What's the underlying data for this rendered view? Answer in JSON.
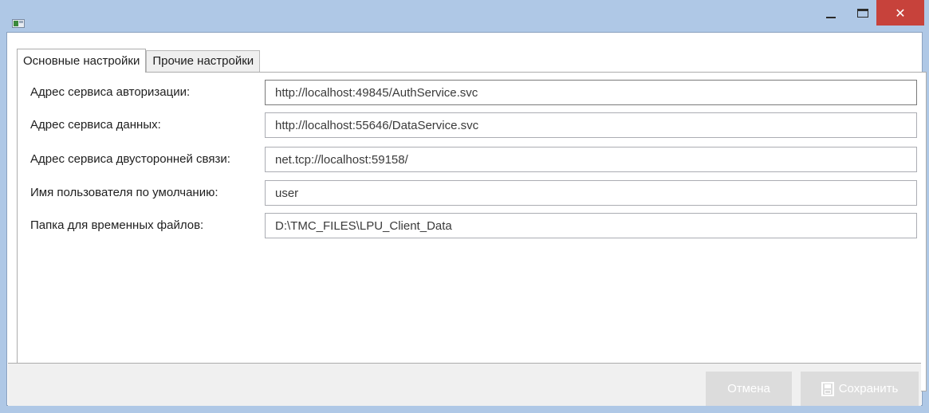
{
  "window": {
    "minimize_glyph": "",
    "close_glyph": "✕"
  },
  "tabs": [
    {
      "label": "Основные настройки",
      "active": true
    },
    {
      "label": "Прочие настройки",
      "active": false
    }
  ],
  "settings": [
    {
      "label": "Адрес сервиса авторизации:",
      "value": "http://localhost:49845/AuthService.svc"
    },
    {
      "label": "Адрес сервиса данных:",
      "value": "http://localhost:55646/DataService.svc"
    },
    {
      "label": "Адрес сервиса двусторонней связи:",
      "value": "net.tcp://localhost:59158/"
    },
    {
      "label": "Имя пользователя по умолчанию:",
      "value": "user"
    },
    {
      "label": "Папка для временных файлов:",
      "value": "D:\\TMC_FILES\\LPU_Client_Data"
    }
  ],
  "footer": {
    "cancel_label": "Отмена",
    "save_label": "Сохранить"
  },
  "colors": {
    "titlebar": "#afc8e6",
    "close_button": "#c7423b",
    "disabled_button": "#dcdcdc"
  }
}
